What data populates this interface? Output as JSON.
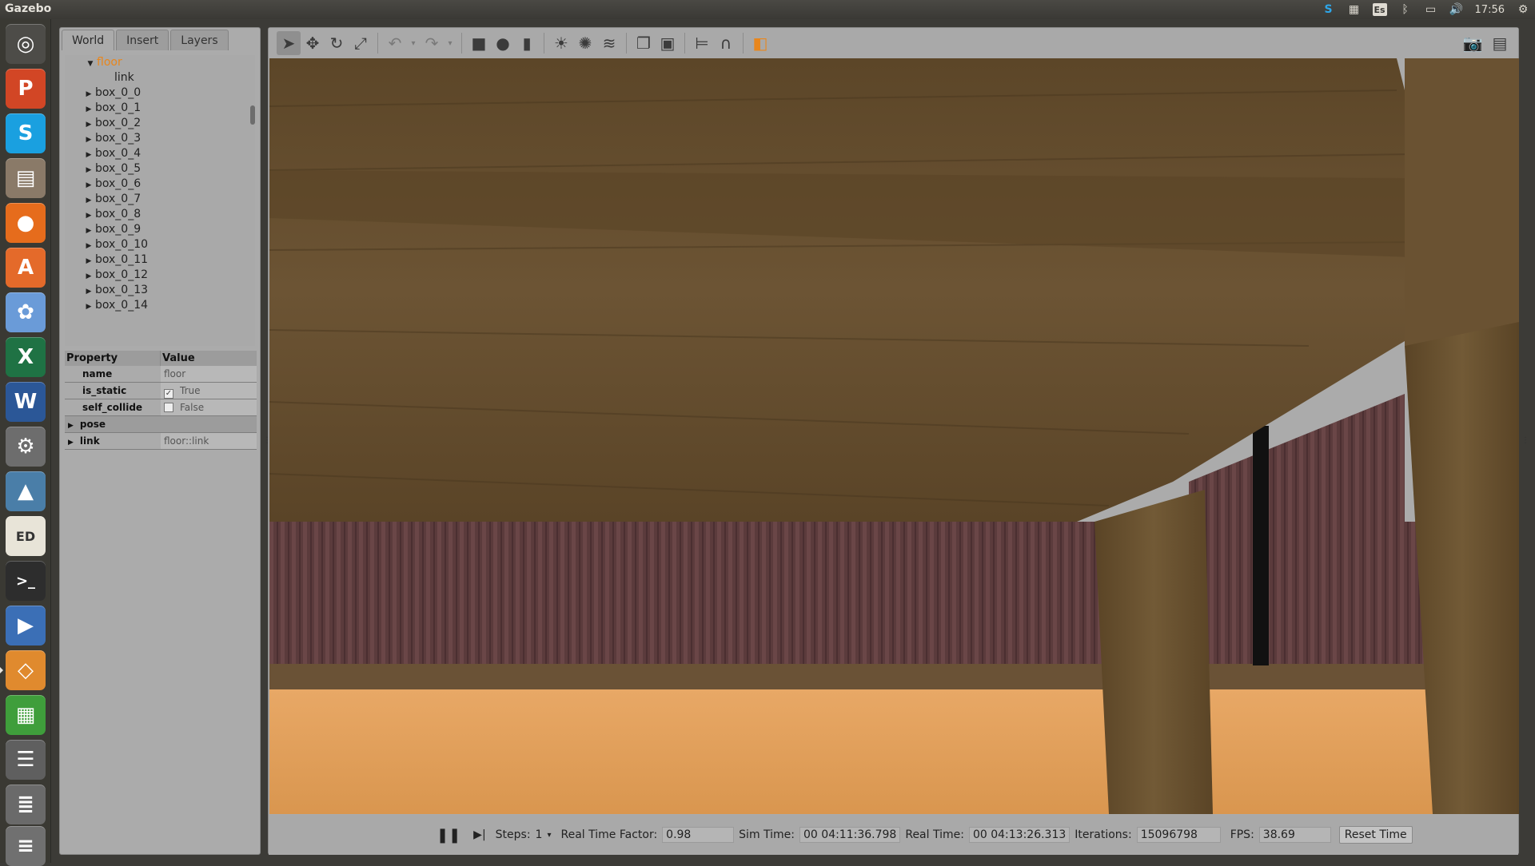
{
  "app": {
    "title": "Gazebo"
  },
  "tray": {
    "clock": "17:56",
    "keyboard": "Es"
  },
  "tabs": [
    {
      "label": "World"
    },
    {
      "label": "Insert"
    },
    {
      "label": "Layers"
    }
  ],
  "tree": {
    "root": "floor",
    "root_child": "link",
    "items": [
      "box_0_0",
      "box_0_1",
      "box_0_2",
      "box_0_3",
      "box_0_4",
      "box_0_5",
      "box_0_6",
      "box_0_7",
      "box_0_8",
      "box_0_9",
      "box_0_10",
      "box_0_11",
      "box_0_12",
      "box_0_13",
      "box_0_14"
    ]
  },
  "properties": {
    "header_property": "Property",
    "header_value": "Value",
    "name_key": "name",
    "name_value": "floor",
    "is_static_key": "is_static",
    "is_static_value": "True",
    "self_collide_key": "self_collide",
    "self_collide_value": "False",
    "pose_key": "pose",
    "link_key": "link",
    "link_value": "floor::link"
  },
  "status": {
    "steps_label": "Steps:",
    "steps_value": "1",
    "rtf_label": "Real Time Factor:",
    "rtf_value": "0.98",
    "sim_label": "Sim Time:",
    "sim_value": "00 04:11:36.798",
    "real_label": "Real Time:",
    "real_value": "00 04:13:26.313",
    "iter_label": "Iterations:",
    "iter_value": "15096798",
    "fps_label": "FPS:",
    "fps_value": "38.69",
    "reset_label": "Reset Time"
  },
  "colors": {
    "selected_item": "#e8861c",
    "wood": "#6a5232",
    "floor": "#e0a060",
    "wall": "#5a3a3a"
  }
}
